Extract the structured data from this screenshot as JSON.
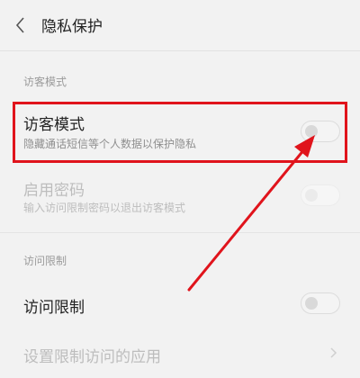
{
  "header": {
    "title": "隐私保护"
  },
  "sections": {
    "guest_mode_header": "访客模式",
    "access_limit_header": "访问限制"
  },
  "rows": {
    "guest_mode": {
      "title": "访客模式",
      "subtitle": "隐藏通话短信等个人数据以保护隐私",
      "enabled": false
    },
    "enable_password": {
      "title": "启用密码",
      "subtitle": "输入访问限制密码以退出访客模式",
      "enabled": false,
      "disabled": true
    },
    "access_limit": {
      "title": "访问限制",
      "enabled": false
    },
    "set_restricted_apps": {
      "title": "设置限制访问的应用"
    }
  },
  "colors": {
    "highlight": "#e0141c",
    "background": "#f2f2f2"
  },
  "icons": {
    "back": "chevron-left-icon",
    "row_chevron": "chevron-right-icon"
  }
}
